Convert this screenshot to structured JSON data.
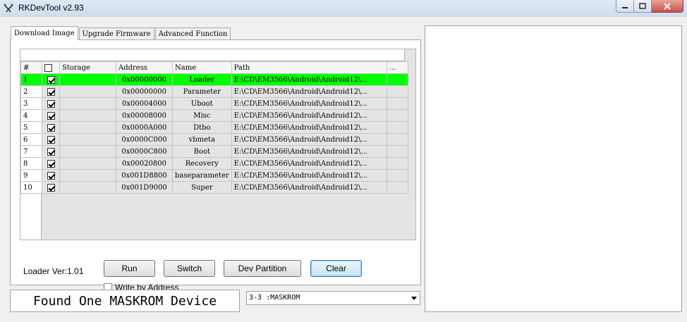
{
  "window": {
    "title": "RKDevTool v2.93",
    "controls": {
      "minimize": "minimize-icon",
      "maximize": "maximize-icon",
      "close": "close-icon"
    }
  },
  "tabs": [
    {
      "label": "Download Image",
      "active": true
    },
    {
      "label": "Upgrade Firmware",
      "active": false
    },
    {
      "label": "Advanced Function",
      "active": false
    }
  ],
  "table": {
    "headers": {
      "num": "#",
      "storage": "Storage",
      "address": "Address",
      "name": "Name",
      "path": "Path",
      "more": "..."
    },
    "rows": [
      {
        "num": "1",
        "checked": true,
        "storage": "",
        "address": "0x00000000",
        "name": "Loader",
        "path": "E:\\CD\\EM3566\\Android\\Android12\\...",
        "selected": true
      },
      {
        "num": "2",
        "checked": true,
        "storage": "",
        "address": "0x00000000",
        "name": "Parameter",
        "path": "E:\\CD\\EM3566\\Android\\Android12\\..."
      },
      {
        "num": "3",
        "checked": true,
        "storage": "",
        "address": "0x00004000",
        "name": "Uboot",
        "path": "E:\\CD\\EM3566\\Android\\Android12\\..."
      },
      {
        "num": "4",
        "checked": true,
        "storage": "",
        "address": "0x00008000",
        "name": "Misc",
        "path": "E:\\CD\\EM3566\\Android\\Android12\\..."
      },
      {
        "num": "5",
        "checked": true,
        "storage": "",
        "address": "0x0000A000",
        "name": "Dtbo",
        "path": "E:\\CD\\EM3566\\Android\\Android12\\..."
      },
      {
        "num": "6",
        "checked": true,
        "storage": "",
        "address": "0x0000C000",
        "name": "vbmeta",
        "path": "E:\\CD\\EM3566\\Android\\Android12\\..."
      },
      {
        "num": "7",
        "checked": true,
        "storage": "",
        "address": "0x0000C800",
        "name": "Boot",
        "path": "E:\\CD\\EM3566\\Android\\Android12\\..."
      },
      {
        "num": "8",
        "checked": true,
        "storage": "",
        "address": "0x00020800",
        "name": "Recovery",
        "path": "E:\\CD\\EM3566\\Android\\Android12\\..."
      },
      {
        "num": "9",
        "checked": true,
        "storage": "",
        "address": "0x001D8800",
        "name": "baseparameter",
        "path": "E:\\CD\\EM3566\\Android\\Android12\\..."
      },
      {
        "num": "10",
        "checked": true,
        "storage": "",
        "address": "0x001D9000",
        "name": "Super",
        "path": "E:\\CD\\EM3566\\Android\\Android12\\..."
      }
    ],
    "selected_row_color": "#00ff00"
  },
  "loader_version": "Loader Ver:1.01",
  "buttons": {
    "run": "Run",
    "switch": "Switch",
    "dev_partition": "Dev Partition",
    "clear": "Clear"
  },
  "write_by_address": {
    "label": "Write by Address",
    "checked": false
  },
  "status_text": "Found One MASKROM Device",
  "device_select": {
    "value": "3-3 :MASKROM"
  }
}
